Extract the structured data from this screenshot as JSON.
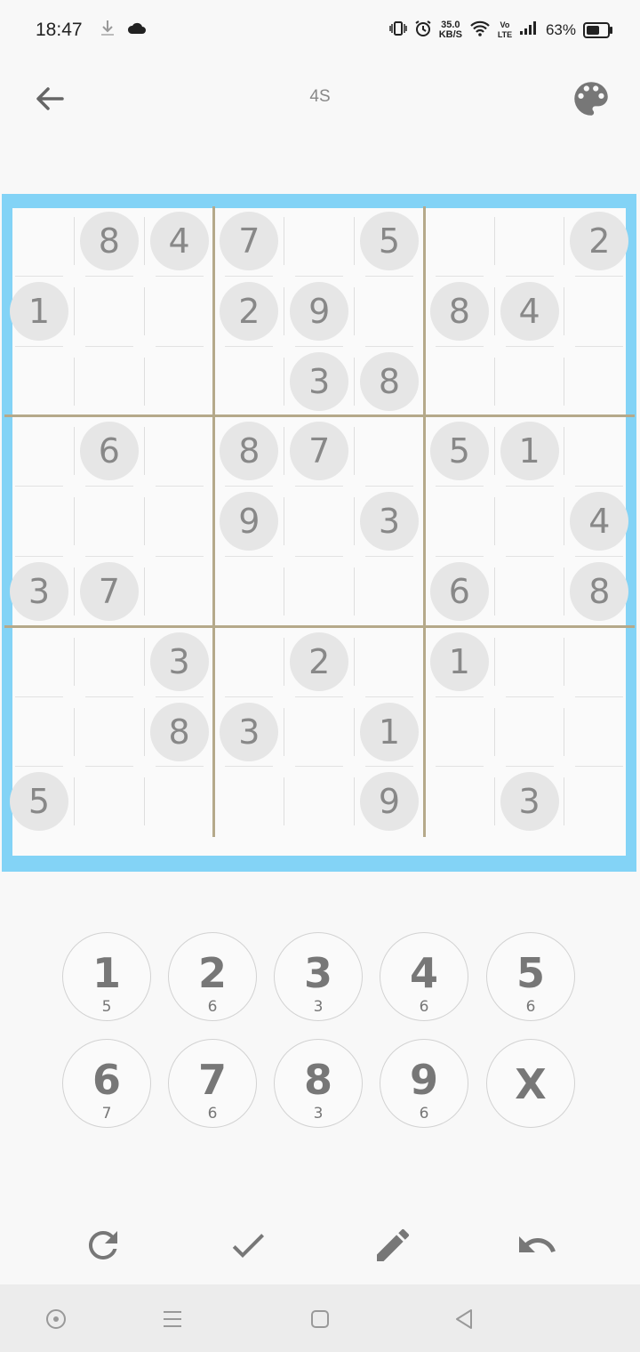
{
  "status_bar": {
    "time": "18:47",
    "net_speed_value": "35.0",
    "net_speed_unit": "KB/S",
    "volte": "Vo LTE",
    "battery_percent": "63%"
  },
  "header": {
    "title": "4S",
    "back_icon": "arrow-left-icon",
    "palette_icon": "palette-icon"
  },
  "board": {
    "frame_color": "#83d3f6",
    "rows": [
      [
        "",
        "8",
        "4",
        "7",
        "",
        "5",
        "",
        "",
        "2"
      ],
      [
        "1",
        "",
        "",
        "2",
        "9",
        "",
        "8",
        "4",
        ""
      ],
      [
        "",
        "",
        "",
        "",
        "3",
        "8",
        "",
        "",
        ""
      ],
      [
        "",
        "6",
        "",
        "8",
        "7",
        "",
        "5",
        "1",
        ""
      ],
      [
        "",
        "",
        "",
        "9",
        "",
        "3",
        "",
        "",
        "4"
      ],
      [
        "3",
        "7",
        "",
        "",
        "",
        "",
        "6",
        "",
        "8"
      ],
      [
        "",
        "",
        "3",
        "",
        "2",
        "",
        "1",
        "",
        ""
      ],
      [
        "",
        "",
        "8",
        "3",
        "",
        "1",
        "",
        "",
        ""
      ],
      [
        "5",
        "",
        "",
        "",
        "",
        "9",
        "",
        "3",
        ""
      ]
    ]
  },
  "keypad": {
    "keys": [
      {
        "label": "1",
        "count": "5"
      },
      {
        "label": "2",
        "count": "6"
      },
      {
        "label": "3",
        "count": "3"
      },
      {
        "label": "4",
        "count": "6"
      },
      {
        "label": "5",
        "count": "6"
      },
      {
        "label": "6",
        "count": "7"
      },
      {
        "label": "7",
        "count": "6"
      },
      {
        "label": "8",
        "count": "3"
      },
      {
        "label": "9",
        "count": "6"
      },
      {
        "label": "X",
        "count": ""
      }
    ]
  },
  "toolbar": {
    "icons": [
      "refresh-icon",
      "check-icon",
      "pencil-icon",
      "undo-icon"
    ]
  },
  "nav_bar": {
    "icons": [
      "assistant-icon",
      "recents-icon",
      "home-icon",
      "back-triangle-icon"
    ]
  }
}
